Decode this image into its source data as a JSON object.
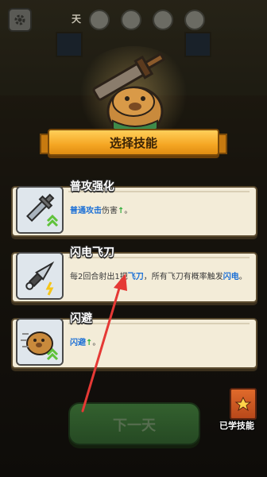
{
  "topbar": {
    "day_label": "天",
    "icons": [
      "gear-icon",
      "heart-icon",
      "coin-icon",
      "skull-icon",
      "shield-icon"
    ]
  },
  "title": "选择技能",
  "skills": [
    {
      "name": "普攻强化",
      "icon": "sword-icon",
      "desc_parts": [
        {
          "text": "普通攻击",
          "style": "hl"
        },
        {
          "text": "伤害",
          "style": ""
        },
        {
          "text": "↑",
          "style": "up"
        },
        {
          "text": "。",
          "style": ""
        }
      ]
    },
    {
      "name": "闪电飞刀",
      "icon": "flying-knife-icon",
      "desc_parts": [
        {
          "text": "每2回合射出1把",
          "style": ""
        },
        {
          "text": "飞刀",
          "style": "hl"
        },
        {
          "text": "，所有飞刀有概率触发",
          "style": ""
        },
        {
          "text": "闪电",
          "style": "hl"
        },
        {
          "text": "。",
          "style": ""
        }
      ]
    },
    {
      "name": "闪避",
      "icon": "capybara-dodge-icon",
      "desc_parts": [
        {
          "text": "闪避",
          "style": "hl"
        },
        {
          "text": "↑",
          "style": "up"
        },
        {
          "text": "。",
          "style": ""
        }
      ]
    }
  ],
  "next_button": "下一天",
  "learned_skills_label": "已学技能",
  "colors": {
    "highlight": "#1b6fd6",
    "up_arrow": "#2fae3a",
    "banner": "#f5a623",
    "annotation_arrow": "#e53935"
  }
}
